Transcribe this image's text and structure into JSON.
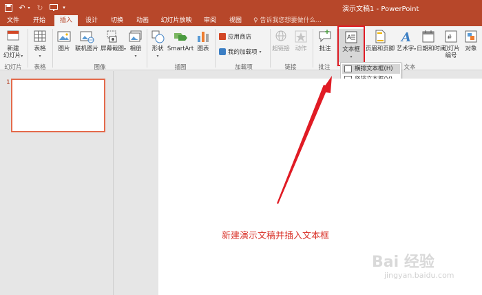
{
  "title_bar": {
    "doc_title": "演示文稿1 - PowerPoint"
  },
  "tabs": [
    "文件",
    "开始",
    "插入",
    "设计",
    "切换",
    "动画",
    "幻灯片放映",
    "审阅",
    "视图"
  ],
  "tell_me": "告诉我您想要做什么...",
  "ribbon": {
    "new_slide": "新建",
    "new_slide_2": "幻灯片",
    "table": "表格",
    "picture": "图片",
    "online_picture": "联机图片",
    "screenshot": "屏幕截图",
    "album": "相册",
    "shapes": "形状",
    "smartart": "SmartArt",
    "chart": "图表",
    "store": "应用商店",
    "my_addins": "我的加载项",
    "hyperlink": "超链接",
    "action": "动作",
    "comment": "批注",
    "textbox": "文本框",
    "header_footer": "页眉和页脚",
    "wordart": "艺术字",
    "datetime": "日期和时间",
    "slide_number": "幻灯片",
    "slide_number_2": "编号",
    "object": "对象"
  },
  "groups": {
    "slides": "幻灯片",
    "tables": "表格",
    "images": "图像",
    "illustrations": "插图",
    "addins": "加载项",
    "links": "链接",
    "comments": "批注",
    "text": "文本"
  },
  "textbox_menu": {
    "horizontal": "横排文本框(H)",
    "vertical": "竖排文本框(V)"
  },
  "slide_thumb_number": "1",
  "annotation": "新建演示文稿并插入文本框",
  "watermark": {
    "logo": "Bai 经验",
    "url": "jingyan.baidu.com"
  },
  "colors": {
    "accent": "#b7472a",
    "highlight": "#e01b24",
    "annotation": "#d9342b"
  }
}
